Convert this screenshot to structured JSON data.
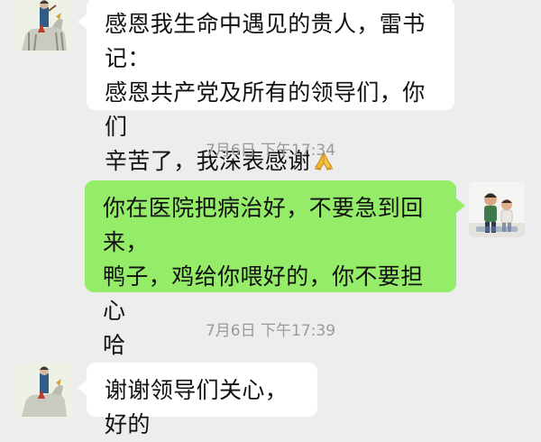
{
  "messages": [
    {
      "direction": "incoming",
      "lines": [
        "感恩我生命中遇见的贵人，雷书记：",
        "感恩共产党及所有的领导们，你们",
        "辛苦了，我深表感谢"
      ],
      "emoji": "praying-hands"
    },
    {
      "timestamp": "7月6日 下午17:34"
    },
    {
      "direction": "outgoing",
      "lines": [
        "你在医院把病治好，不要急到回来，",
        "鸭子，鸡给你喂好的，你不要担心",
        "哈"
      ]
    },
    {
      "timestamp": "7月6日 下午17:39"
    },
    {
      "direction": "incoming",
      "lines": [
        "谢谢领导们关心，好的"
      ]
    }
  ],
  "colors": {
    "background": "#ededed",
    "incoming_bubble": "#ffffff",
    "outgoing_bubble": "#95ec69",
    "timestamp_text": "#9a9a9a"
  }
}
